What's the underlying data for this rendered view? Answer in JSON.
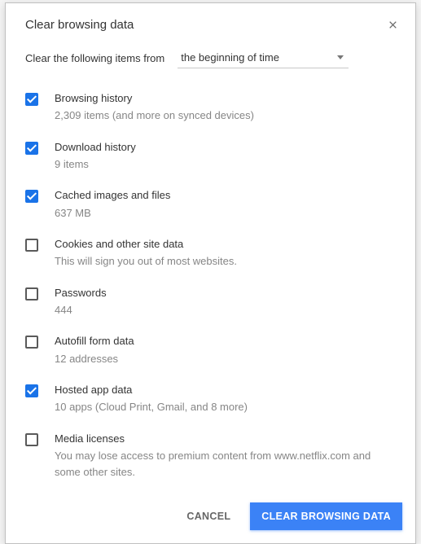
{
  "dialog": {
    "title": "Clear browsing data",
    "prompt": "Clear the following items from",
    "timerange": "the beginning of time"
  },
  "items": [
    {
      "checked": true,
      "label": "Browsing history",
      "sub": "2,309 items (and more on synced devices)"
    },
    {
      "checked": true,
      "label": "Download history",
      "sub": "9 items"
    },
    {
      "checked": true,
      "label": "Cached images and files",
      "sub": "637 MB"
    },
    {
      "checked": false,
      "label": "Cookies and other site data",
      "sub": "This will sign you out of most websites."
    },
    {
      "checked": false,
      "label": "Passwords",
      "sub": "444"
    },
    {
      "checked": false,
      "label": "Autofill form data",
      "sub": "12 addresses"
    },
    {
      "checked": true,
      "label": "Hosted app data",
      "sub": "10 apps (Cloud Print, Gmail, and 8 more)"
    },
    {
      "checked": false,
      "label": "Media licenses",
      "sub": "You may lose access to premium content from www.netflix.com and some other sites."
    }
  ],
  "footer": {
    "cancel": "Cancel",
    "confirm": "Clear browsing data"
  }
}
